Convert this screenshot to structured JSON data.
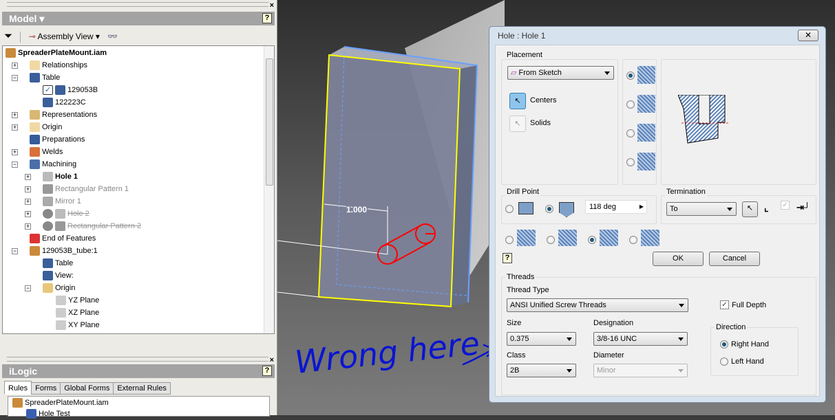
{
  "model_panel": {
    "title": "Model",
    "view_label": "Assembly View",
    "tree": [
      {
        "label": "SpreaderPlateMount.iam",
        "bold": true
      },
      {
        "label": "Relationships"
      },
      {
        "label": "Table"
      },
      {
        "label": "129053B",
        "checked": true
      },
      {
        "label": "122223C"
      },
      {
        "label": "Representations"
      },
      {
        "label": "Origin"
      },
      {
        "label": "Preparations"
      },
      {
        "label": "Welds"
      },
      {
        "label": "Machining"
      },
      {
        "label": "Hole 1",
        "bold": true
      },
      {
        "label": "Rectangular Pattern 1",
        "state": "dim"
      },
      {
        "label": "Mirror 1",
        "state": "dim"
      },
      {
        "label": "Hole 2",
        "state": "suppressed"
      },
      {
        "label": "Rectangular Pattern 2",
        "state": "suppressed"
      },
      {
        "label": "End of Features"
      },
      {
        "label": "129053B_tube:1"
      },
      {
        "label": "Table"
      },
      {
        "label": "View:"
      },
      {
        "label": "Origin"
      },
      {
        "label": "YZ Plane"
      },
      {
        "label": "XZ Plane"
      },
      {
        "label": "XY Plane"
      }
    ]
  },
  "ilogic_panel": {
    "title": "iLogic",
    "tabs": [
      "Rules",
      "Forms",
      "Global Forms",
      "External Rules"
    ],
    "active_tab": "Rules",
    "items": [
      "SpreaderPlateMount.iam",
      "Hole Test"
    ]
  },
  "viewport": {
    "dimension": "1.000",
    "annotation": "Wrong here",
    "colors": {
      "edge_selected": "#ffff00",
      "hole_preview": "#ff0000",
      "annotation": "#0a14d2"
    }
  },
  "dialog": {
    "title": "Hole : Hole 1",
    "placement": {
      "label": "Placement",
      "value": "From Sketch",
      "centers": "Centers",
      "solids": "Solids"
    },
    "drill_point": {
      "label": "Drill Point",
      "angle": "118 deg",
      "selected": "angled"
    },
    "termination": {
      "label": "Termination",
      "value": "To"
    },
    "ok": "OK",
    "cancel": "Cancel",
    "threads": {
      "label": "Threads",
      "thread_type_label": "Thread Type",
      "thread_type": "ANSI Unified Screw Threads",
      "full_depth": "Full Depth",
      "full_depth_checked": true,
      "size_label": "Size",
      "size": "0.375",
      "designation_label": "Designation",
      "designation": "3/8-16 UNC",
      "class_label": "Class",
      "class": "2B",
      "diameter_label": "Diameter",
      "diameter": "Minor",
      "direction_label": "Direction",
      "right_hand": "Right Hand",
      "left_hand": "Left Hand",
      "direction_selected": "Right Hand"
    }
  }
}
